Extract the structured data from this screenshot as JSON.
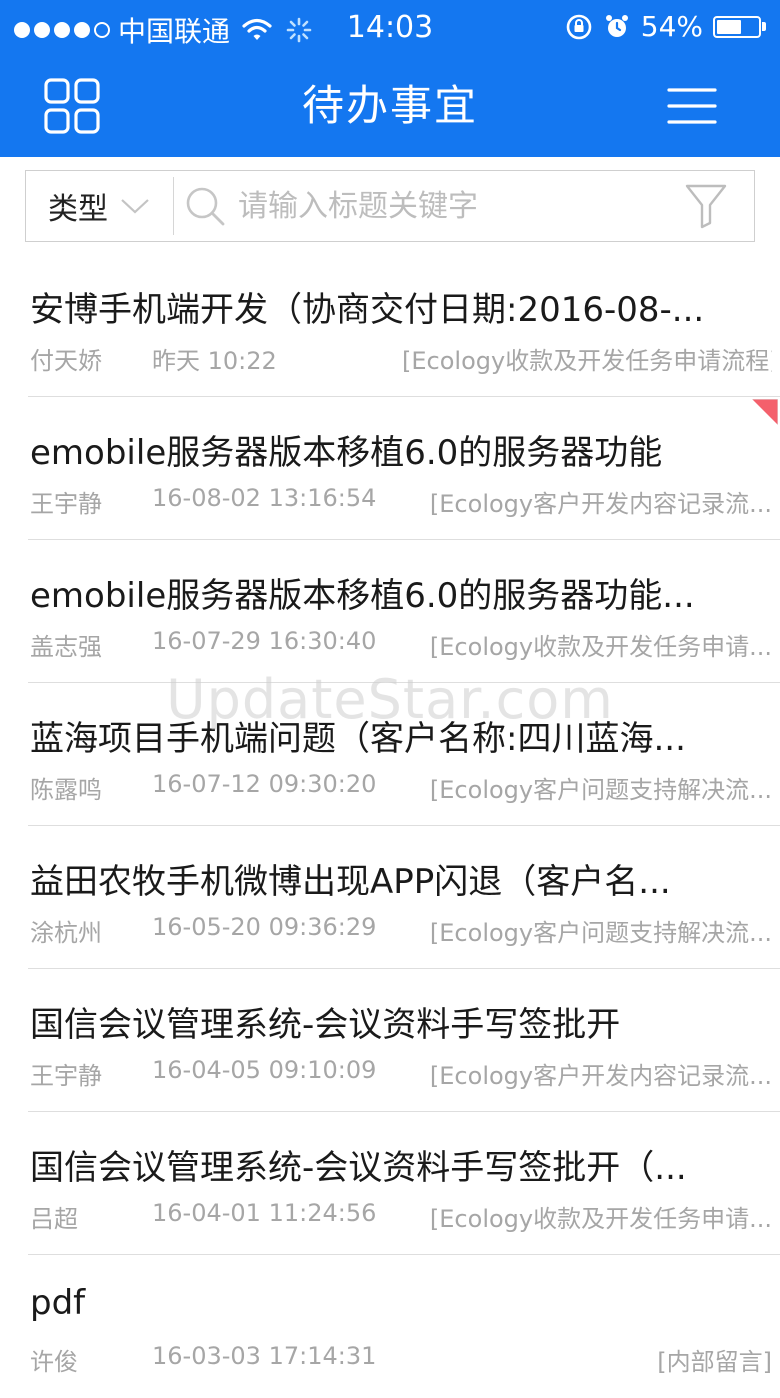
{
  "status_bar": {
    "carrier": "中国联通",
    "time": "14:03",
    "battery": "54%",
    "signal_icon": "signal-dots-icon",
    "wifi_icon": "wifi-icon",
    "loading_icon": "activity-spinner-icon",
    "rotation_lock_icon": "rotation-lock-icon",
    "alarm_icon": "alarm-icon"
  },
  "nav": {
    "title": "待办事宜",
    "left_icon": "grid-apps-icon",
    "right_icon": "hamburger-menu-icon"
  },
  "search": {
    "type_label": "类型",
    "placeholder": "请输入标题关键字",
    "search_icon": "search-icon",
    "filter_icon": "filter-icon"
  },
  "items": [
    {
      "title": "安博手机端开发（协商交付日期:2016-08-...",
      "user": "付天娇",
      "time": "昨天 10:22",
      "flow": "[Ecology收款及开发任务申请流程]",
      "flagged": false
    },
    {
      "title": "emobile服务器版本移植6.0的服务器功能",
      "user": "王宇静",
      "time": "16-08-02 13:16:54",
      "flow": "[Ecology客户开发内容记录流...",
      "flagged": true
    },
    {
      "title": "emobile服务器版本移植6.0的服务器功能...",
      "user": "盖志强",
      "time": "16-07-29 16:30:40",
      "flow": "[Ecology收款及开发任务申请...",
      "flagged": false
    },
    {
      "title": "蓝海项目手机端问题（客户名称:四川蓝海...",
      "user": "陈露鸣",
      "time": "16-07-12 09:30:20",
      "flow": "[Ecology客户问题支持解决流...",
      "flagged": false
    },
    {
      "title": "益田农牧手机微博出现APP闪退（客户名...",
      "user": "涂杭州",
      "time": "16-05-20 09:36:29",
      "flow": "[Ecology客户问题支持解决流...",
      "flagged": false
    },
    {
      "title": "国信会议管理系统-会议资料手写签批开",
      "user": "王宇静",
      "time": "16-04-05 09:10:09",
      "flow": "[Ecology客户开发内容记录流...",
      "flagged": false
    },
    {
      "title": "国信会议管理系统-会议资料手写签批开（...",
      "user": "吕超",
      "time": "16-04-01 11:24:56",
      "flow": "[Ecology收款及开发任务申请...",
      "flagged": false
    },
    {
      "title": "pdf",
      "user": "许俊",
      "time": "16-03-03 17:14:31",
      "flow": "[内部留言]",
      "flagged": false
    }
  ],
  "watermark": "UpdateStar.com",
  "colors": {
    "header_bg": "#1477f0",
    "flag": "#f4606c"
  }
}
